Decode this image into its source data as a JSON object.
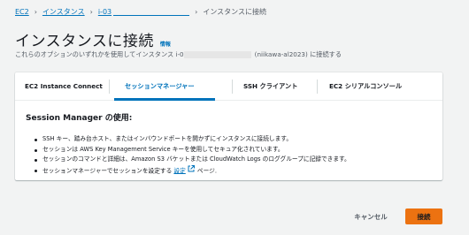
{
  "breadcrumb": {
    "items": [
      {
        "label": "EC2"
      },
      {
        "label": "インスタンス"
      },
      {
        "label": "i-03"
      },
      {
        "label": "インスタンスに接続"
      }
    ],
    "separator": "›"
  },
  "header": {
    "title": "インスタンスに接続",
    "info_label": "情報",
    "subtitle_before": "これらのオプションのいずれかを使用してインスタンス i-0",
    "subtitle_after": "(niikawa-al2023) に接続する"
  },
  "tabs": [
    {
      "label": "EC2 Instance Connect"
    },
    {
      "label": "セッションマネージャー"
    },
    {
      "label": "SSH クライアント"
    },
    {
      "label": "EC2 シリアルコンソール"
    }
  ],
  "session_manager": {
    "title": "Session Manager の使用:",
    "bullets": [
      "SSH キー、踏み台ホスト、またはインバウンドポートを開かずにインスタンスに接続します。",
      "セッションは AWS Key Management Service キーを使用してセキュア化されています。",
      "セッションのコマンドと詳細は、Amazon S3 バケットまたは CloudWatch Logs のロググループに記録できます。"
    ],
    "last_bullet_before": "セッションマネージャーでセッションを設定する",
    "last_bullet_link": "設定",
    "last_bullet_after": "ページ."
  },
  "footer": {
    "cancel_label": "キャンセル",
    "connect_label": "接続"
  },
  "colors": {
    "link": "#0073bb",
    "primary_button": "#ec7211",
    "background": "#f2f3f3"
  },
  "icons": {
    "external_link": "external-link-icon"
  }
}
